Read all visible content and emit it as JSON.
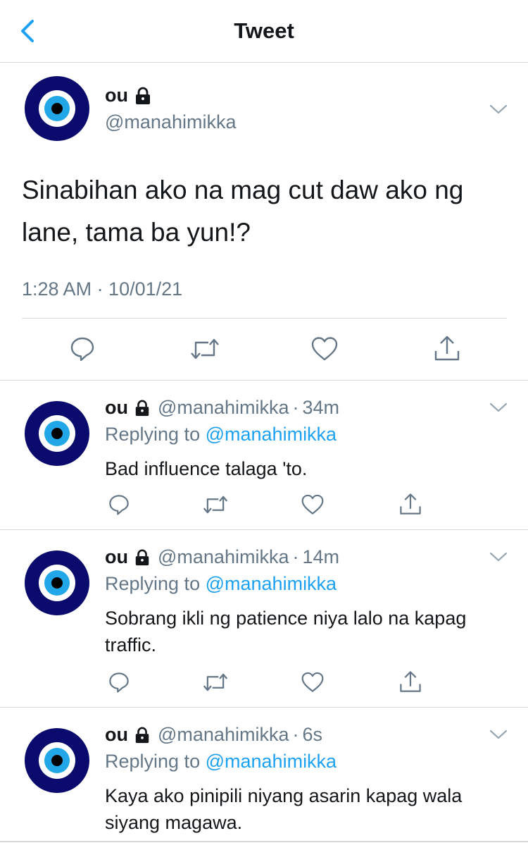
{
  "header": {
    "title": "Tweet"
  },
  "main_tweet": {
    "name": "ou",
    "handle": "@manahimikka",
    "text": "Sinabihan ako na mag cut daw ako ng lane, tama ba yun!?",
    "timestamp": "1:28 AM · 10/01/21"
  },
  "replies": [
    {
      "name": "ou",
      "handle": "@manahimikka",
      "time": "34m",
      "replying_prefix": "Replying to",
      "replying_handle": "@manahimikka",
      "text": "Bad influence talaga 'to."
    },
    {
      "name": "ou",
      "handle": "@manahimikka",
      "time": "14m",
      "replying_prefix": "Replying to",
      "replying_handle": "@manahimikka",
      "text": "Sobrang ikli ng patience niya lalo na kapag traffic."
    },
    {
      "name": "ou",
      "handle": "@manahimikka",
      "time": "6s",
      "replying_prefix": "Replying to",
      "replying_handle": "@manahimikka",
      "text": "Kaya ako pinipili niyang asarin kapag wala siyang magawa."
    }
  ],
  "separator": "·",
  "icons": {
    "back": "chevron-left-icon",
    "lock": "lock-icon",
    "more": "chevron-down-icon",
    "reply": "reply-icon",
    "retweet": "retweet-icon",
    "like": "heart-icon",
    "share": "share-icon"
  },
  "colors": {
    "accent": "#1da1f2",
    "text": "#14171a",
    "secondary": "#657786",
    "divider": "#d6d9db",
    "avatar_dark_blue": "#0b0b6e",
    "avatar_light_blue": "#21a7e8"
  }
}
